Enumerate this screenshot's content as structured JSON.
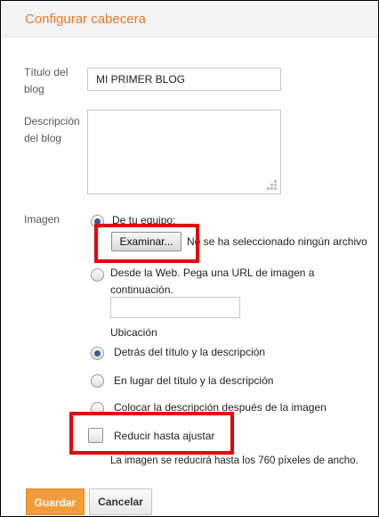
{
  "dialog": {
    "title": "Configurar cabecera"
  },
  "form": {
    "blog_title_label_1": "Título del",
    "blog_title_label_2": "blog",
    "blog_title_value": "MI PRIMER BLOG",
    "description_label_1": "Descripción",
    "description_label_2": "del blog",
    "description_value": "",
    "image_label": "Imagen",
    "from_computer_label": "De tu equipo:",
    "browse_button": "Examinar...",
    "no_file_text": "No se ha seleccionado ningún archivo",
    "from_web_label_1": "Desde la Web. Pega una URL de imagen a",
    "from_web_label_2": "continuación.",
    "url_value": "",
    "placement_heading": "Ubicación",
    "placement_options": [
      "Detrás del título y la descripción",
      "En lugar del título y la descripción",
      "Colocar la descripción después de la imagen"
    ],
    "shrink_label": "Reducir hasta ajustar",
    "shrink_checked": false,
    "shrink_note": "La imagen se reducirá hasta los 760 píxeles de ancho."
  },
  "actions": {
    "save": "Guardar",
    "cancel": "Cancelar"
  },
  "colors": {
    "accent": "#e87722",
    "highlight": "#e8000b",
    "save_bg": "#f39c3b"
  }
}
